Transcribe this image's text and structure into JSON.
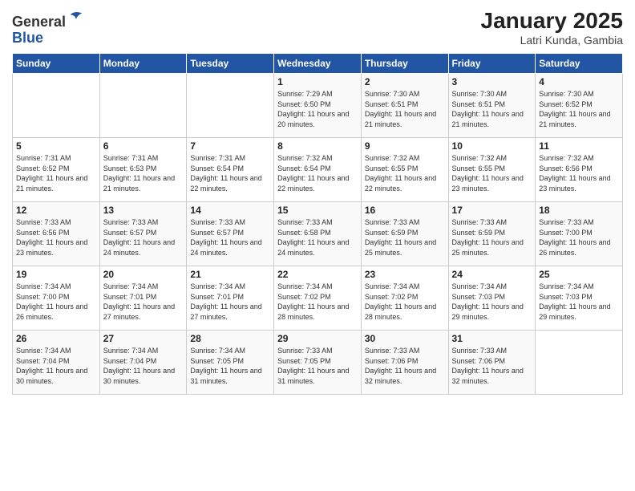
{
  "header": {
    "logo_line1": "General",
    "logo_line2": "Blue",
    "title": "January 2025",
    "subtitle": "Latri Kunda, Gambia"
  },
  "days_of_week": [
    "Sunday",
    "Monday",
    "Tuesday",
    "Wednesday",
    "Thursday",
    "Friday",
    "Saturday"
  ],
  "weeks": [
    [
      {
        "num": "",
        "info": ""
      },
      {
        "num": "",
        "info": ""
      },
      {
        "num": "",
        "info": ""
      },
      {
        "num": "1",
        "info": "Sunrise: 7:29 AM\nSunset: 6:50 PM\nDaylight: 11 hours and 20 minutes."
      },
      {
        "num": "2",
        "info": "Sunrise: 7:30 AM\nSunset: 6:51 PM\nDaylight: 11 hours and 21 minutes."
      },
      {
        "num": "3",
        "info": "Sunrise: 7:30 AM\nSunset: 6:51 PM\nDaylight: 11 hours and 21 minutes."
      },
      {
        "num": "4",
        "info": "Sunrise: 7:30 AM\nSunset: 6:52 PM\nDaylight: 11 hours and 21 minutes."
      }
    ],
    [
      {
        "num": "5",
        "info": "Sunrise: 7:31 AM\nSunset: 6:52 PM\nDaylight: 11 hours and 21 minutes."
      },
      {
        "num": "6",
        "info": "Sunrise: 7:31 AM\nSunset: 6:53 PM\nDaylight: 11 hours and 21 minutes."
      },
      {
        "num": "7",
        "info": "Sunrise: 7:31 AM\nSunset: 6:54 PM\nDaylight: 11 hours and 22 minutes."
      },
      {
        "num": "8",
        "info": "Sunrise: 7:32 AM\nSunset: 6:54 PM\nDaylight: 11 hours and 22 minutes."
      },
      {
        "num": "9",
        "info": "Sunrise: 7:32 AM\nSunset: 6:55 PM\nDaylight: 11 hours and 22 minutes."
      },
      {
        "num": "10",
        "info": "Sunrise: 7:32 AM\nSunset: 6:55 PM\nDaylight: 11 hours and 23 minutes."
      },
      {
        "num": "11",
        "info": "Sunrise: 7:32 AM\nSunset: 6:56 PM\nDaylight: 11 hours and 23 minutes."
      }
    ],
    [
      {
        "num": "12",
        "info": "Sunrise: 7:33 AM\nSunset: 6:56 PM\nDaylight: 11 hours and 23 minutes."
      },
      {
        "num": "13",
        "info": "Sunrise: 7:33 AM\nSunset: 6:57 PM\nDaylight: 11 hours and 24 minutes."
      },
      {
        "num": "14",
        "info": "Sunrise: 7:33 AM\nSunset: 6:57 PM\nDaylight: 11 hours and 24 minutes."
      },
      {
        "num": "15",
        "info": "Sunrise: 7:33 AM\nSunset: 6:58 PM\nDaylight: 11 hours and 24 minutes."
      },
      {
        "num": "16",
        "info": "Sunrise: 7:33 AM\nSunset: 6:59 PM\nDaylight: 11 hours and 25 minutes."
      },
      {
        "num": "17",
        "info": "Sunrise: 7:33 AM\nSunset: 6:59 PM\nDaylight: 11 hours and 25 minutes."
      },
      {
        "num": "18",
        "info": "Sunrise: 7:33 AM\nSunset: 7:00 PM\nDaylight: 11 hours and 26 minutes."
      }
    ],
    [
      {
        "num": "19",
        "info": "Sunrise: 7:34 AM\nSunset: 7:00 PM\nDaylight: 11 hours and 26 minutes."
      },
      {
        "num": "20",
        "info": "Sunrise: 7:34 AM\nSunset: 7:01 PM\nDaylight: 11 hours and 27 minutes."
      },
      {
        "num": "21",
        "info": "Sunrise: 7:34 AM\nSunset: 7:01 PM\nDaylight: 11 hours and 27 minutes."
      },
      {
        "num": "22",
        "info": "Sunrise: 7:34 AM\nSunset: 7:02 PM\nDaylight: 11 hours and 28 minutes."
      },
      {
        "num": "23",
        "info": "Sunrise: 7:34 AM\nSunset: 7:02 PM\nDaylight: 11 hours and 28 minutes."
      },
      {
        "num": "24",
        "info": "Sunrise: 7:34 AM\nSunset: 7:03 PM\nDaylight: 11 hours and 29 minutes."
      },
      {
        "num": "25",
        "info": "Sunrise: 7:34 AM\nSunset: 7:03 PM\nDaylight: 11 hours and 29 minutes."
      }
    ],
    [
      {
        "num": "26",
        "info": "Sunrise: 7:34 AM\nSunset: 7:04 PM\nDaylight: 11 hours and 30 minutes."
      },
      {
        "num": "27",
        "info": "Sunrise: 7:34 AM\nSunset: 7:04 PM\nDaylight: 11 hours and 30 minutes."
      },
      {
        "num": "28",
        "info": "Sunrise: 7:34 AM\nSunset: 7:05 PM\nDaylight: 11 hours and 31 minutes."
      },
      {
        "num": "29",
        "info": "Sunrise: 7:33 AM\nSunset: 7:05 PM\nDaylight: 11 hours and 31 minutes."
      },
      {
        "num": "30",
        "info": "Sunrise: 7:33 AM\nSunset: 7:06 PM\nDaylight: 11 hours and 32 minutes."
      },
      {
        "num": "31",
        "info": "Sunrise: 7:33 AM\nSunset: 7:06 PM\nDaylight: 11 hours and 32 minutes."
      },
      {
        "num": "",
        "info": ""
      }
    ]
  ]
}
